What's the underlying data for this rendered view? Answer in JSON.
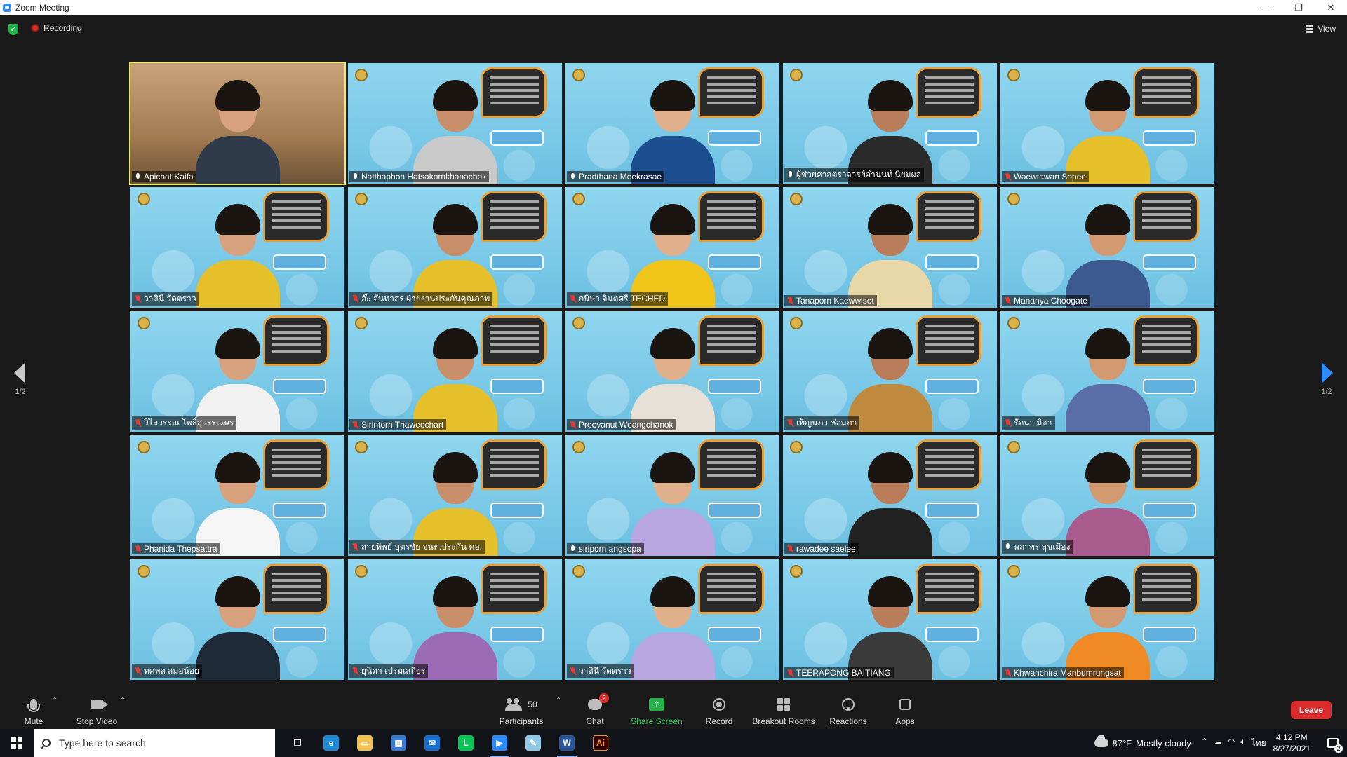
{
  "window": {
    "title": "Zoom Meeting",
    "controls": [
      "minimize",
      "restore",
      "close"
    ]
  },
  "meeting_topbar": {
    "recording_label": "Recording",
    "view_label": "View"
  },
  "pagination": {
    "left": "1/2",
    "right": "1/2"
  },
  "participants_grid": [
    {
      "name": "Apichat Kaifa",
      "muted": false,
      "active_speaker": true,
      "bg": "room"
    },
    {
      "name": "Natthaphon Hatsakornkhanachok",
      "muted": false,
      "active_speaker": false,
      "bg": "blue"
    },
    {
      "name": "Pradthana Meekrasae",
      "muted": false,
      "active_speaker": false,
      "bg": "blue"
    },
    {
      "name": "ผู้ช่วยศาสตราจารย์อำนนท์ นิยมผล",
      "muted": false,
      "active_speaker": false,
      "bg": "blue"
    },
    {
      "name": "Waewtawan Sopee",
      "muted": true,
      "active_speaker": false,
      "bg": "blue"
    },
    {
      "name": "วาสินี วัดตราว",
      "muted": true,
      "active_speaker": false,
      "bg": "blue"
    },
    {
      "name": "อ๊ะ จันทาสร ฝ่ายงานประกันคุณภาพ",
      "muted": true,
      "active_speaker": false,
      "bg": "blue"
    },
    {
      "name": "กนิษา จินตศรี.TECHED",
      "muted": true,
      "active_speaker": false,
      "bg": "blue"
    },
    {
      "name": "Tanaporn Kaewwiset",
      "muted": true,
      "active_speaker": false,
      "bg": "blue"
    },
    {
      "name": "Mananya Choogate",
      "muted": true,
      "active_speaker": false,
      "bg": "blue"
    },
    {
      "name": "วิไลวรรณ โพธิ์สุวรรณพร",
      "muted": true,
      "active_speaker": false,
      "bg": "blue"
    },
    {
      "name": "Sirintorn Thaweechart",
      "muted": true,
      "active_speaker": false,
      "bg": "blue"
    },
    {
      "name": "Preeyanut Weangchanok",
      "muted": true,
      "active_speaker": false,
      "bg": "blue"
    },
    {
      "name": "เพ็ญนภา ช่อมภา",
      "muted": true,
      "active_speaker": false,
      "bg": "blue"
    },
    {
      "name": "รัตนา มิสา",
      "muted": true,
      "active_speaker": false,
      "bg": "blue"
    },
    {
      "name": "Phanida Thepsattra",
      "muted": true,
      "active_speaker": false,
      "bg": "blue"
    },
    {
      "name": "สายทิพย์ บุตรชัย จนท.ประกัน คอ.",
      "muted": true,
      "active_speaker": false,
      "bg": "blue"
    },
    {
      "name": "siriporn angsopa",
      "muted": false,
      "active_speaker": false,
      "bg": "blue"
    },
    {
      "name": "rawadee saelee",
      "muted": true,
      "active_speaker": false,
      "bg": "blue"
    },
    {
      "name": "พลาพร สุขเมือง",
      "muted": false,
      "active_speaker": false,
      "bg": "blue"
    },
    {
      "name": "ทศพล สมอน้อย",
      "muted": true,
      "active_speaker": false,
      "bg": "blue"
    },
    {
      "name": "ยุนิดา เปรมเสถียร",
      "muted": true,
      "active_speaker": false,
      "bg": "blue"
    },
    {
      "name": "วาสินี วัดตราว",
      "muted": true,
      "active_speaker": false,
      "bg": "blue"
    },
    {
      "name": "TEERAPONG  BAITIANG",
      "muted": true,
      "active_speaker": false,
      "bg": "blue"
    },
    {
      "name": "Khwanchira Manbumrungsat",
      "muted": true,
      "active_speaker": false,
      "bg": "blue"
    }
  ],
  "controls": {
    "mute_label": "Mute",
    "stop_video_label": "Stop Video",
    "participants_label": "Participants",
    "participants_count": "50",
    "chat_label": "Chat",
    "chat_badge": "2",
    "share_screen_label": "Share Screen",
    "record_label": "Record",
    "breakout_label": "Breakout Rooms",
    "reactions_label": "Reactions",
    "apps_label": "Apps",
    "leave_label": "Leave"
  },
  "taskbar": {
    "search_placeholder": "Type here to search",
    "apps": [
      {
        "name": "task-view-icon",
        "color": "#101317",
        "glyph": "❐",
        "running": false
      },
      {
        "name": "edge-icon",
        "color": "#1f8bd6",
        "glyph": "e",
        "running": false
      },
      {
        "name": "file-explorer-icon",
        "color": "#f2c14e",
        "glyph": "▭",
        "running": false
      },
      {
        "name": "store-icon",
        "color": "#3a7bd5",
        "glyph": "▦",
        "running": false
      },
      {
        "name": "mail-icon",
        "color": "#1570d6",
        "glyph": "✉",
        "running": false
      },
      {
        "name": "line-icon",
        "color": "#06c755",
        "glyph": "L",
        "running": false
      },
      {
        "name": "zoom-icon",
        "color": "#2D8CFF",
        "glyph": "▶",
        "running": true
      },
      {
        "name": "notes-icon",
        "color": "#8fc9e6",
        "glyph": "✎",
        "running": false
      },
      {
        "name": "word-icon",
        "color": "#2b579a",
        "glyph": "W",
        "running": true
      },
      {
        "name": "illustrator-icon",
        "color": "#330000",
        "glyph": "Ai",
        "running": false
      }
    ],
    "weather_temp": "87°F",
    "weather_text": "Mostly cloudy",
    "language": "ไทย",
    "time": "4:12 PM",
    "date": "8/27/2021",
    "notification_count": "2"
  }
}
